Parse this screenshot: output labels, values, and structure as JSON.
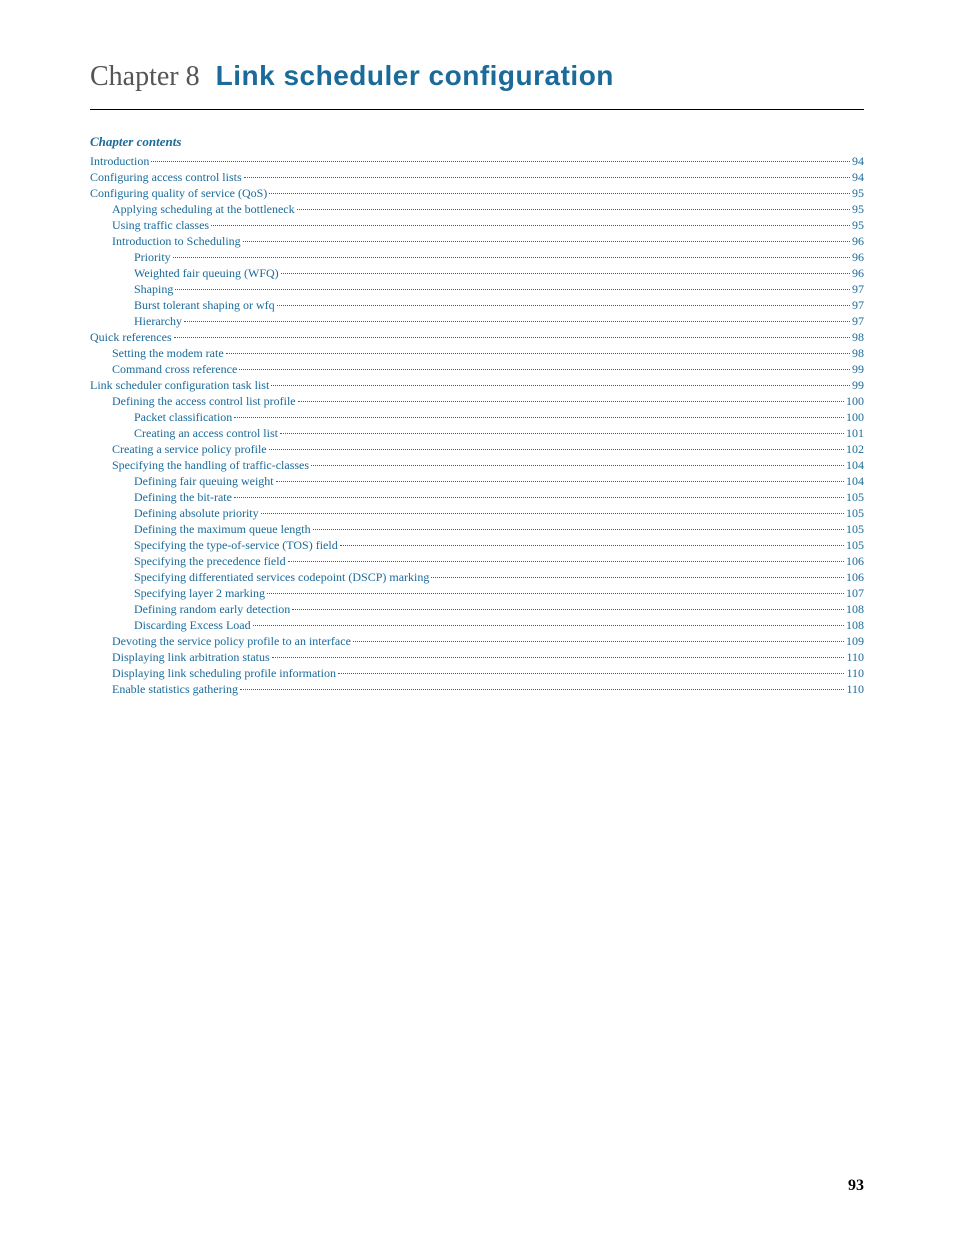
{
  "chapter": {
    "label": "Chapter 8",
    "title": "Link scheduler configuration"
  },
  "contents_label": "Chapter contents",
  "toc": [
    {
      "level": 0,
      "text": "Introduction",
      "page": "94"
    },
    {
      "level": 0,
      "text": "Configuring access control lists",
      "page": "94"
    },
    {
      "level": 0,
      "text": "Configuring quality of service (QoS)",
      "page": "95"
    },
    {
      "level": 1,
      "text": "Applying scheduling at the bottleneck",
      "page": "95"
    },
    {
      "level": 1,
      "text": "Using traffic classes",
      "page": "95"
    },
    {
      "level": 1,
      "text": "Introduction to Scheduling",
      "page": "96"
    },
    {
      "level": 2,
      "text": "Priority",
      "page": "96"
    },
    {
      "level": 2,
      "text": "Weighted fair queuing (WFQ)",
      "page": "96"
    },
    {
      "level": 2,
      "text": "Shaping",
      "page": "97"
    },
    {
      "level": 2,
      "text": "Burst tolerant shaping or wfq",
      "page": "97"
    },
    {
      "level": 2,
      "text": "Hierarchy",
      "page": "97"
    },
    {
      "level": 0,
      "text": "Quick references",
      "page": "98"
    },
    {
      "level": 1,
      "text": "Setting the modem rate",
      "page": "98"
    },
    {
      "level": 1,
      "text": "Command cross reference",
      "page": "99"
    },
    {
      "level": 0,
      "text": "Link scheduler configuration task list",
      "page": "99"
    },
    {
      "level": 1,
      "text": "Defining the access control list profile",
      "page": "100"
    },
    {
      "level": 2,
      "text": "Packet classification",
      "page": "100"
    },
    {
      "level": 2,
      "text": "Creating an access control list",
      "page": "101"
    },
    {
      "level": 1,
      "text": "Creating a service policy profile",
      "page": "102"
    },
    {
      "level": 1,
      "text": "Specifying the handling of traffic-classes",
      "page": "104"
    },
    {
      "level": 2,
      "text": "Defining fair queuing weight",
      "page": "104"
    },
    {
      "level": 2,
      "text": "Defining the bit-rate",
      "page": "105"
    },
    {
      "level": 2,
      "text": "Defining absolute priority",
      "page": "105"
    },
    {
      "level": 2,
      "text": "Defining the maximum queue length",
      "page": "105"
    },
    {
      "level": 2,
      "text": "Specifying the type-of-service (TOS) field",
      "page": "105"
    },
    {
      "level": 2,
      "text": "Specifying the precedence field",
      "page": "106"
    },
    {
      "level": 2,
      "text": "Specifying differentiated services codepoint (DSCP) marking",
      "page": "106"
    },
    {
      "level": 2,
      "text": "Specifying layer 2 marking",
      "page": "107"
    },
    {
      "level": 2,
      "text": "Defining random early detection",
      "page": "108"
    },
    {
      "level": 2,
      "text": "Discarding Excess Load",
      "page": "108"
    },
    {
      "level": 1,
      "text": "Devoting the service policy profile to an interface",
      "page": "109"
    },
    {
      "level": 1,
      "text": "Displaying link arbitration status",
      "page": "110"
    },
    {
      "level": 1,
      "text": "Displaying link scheduling profile information",
      "page": "110"
    },
    {
      "level": 1,
      "text": "Enable statistics gathering",
      "page": "110"
    }
  ],
  "page_number": "93"
}
